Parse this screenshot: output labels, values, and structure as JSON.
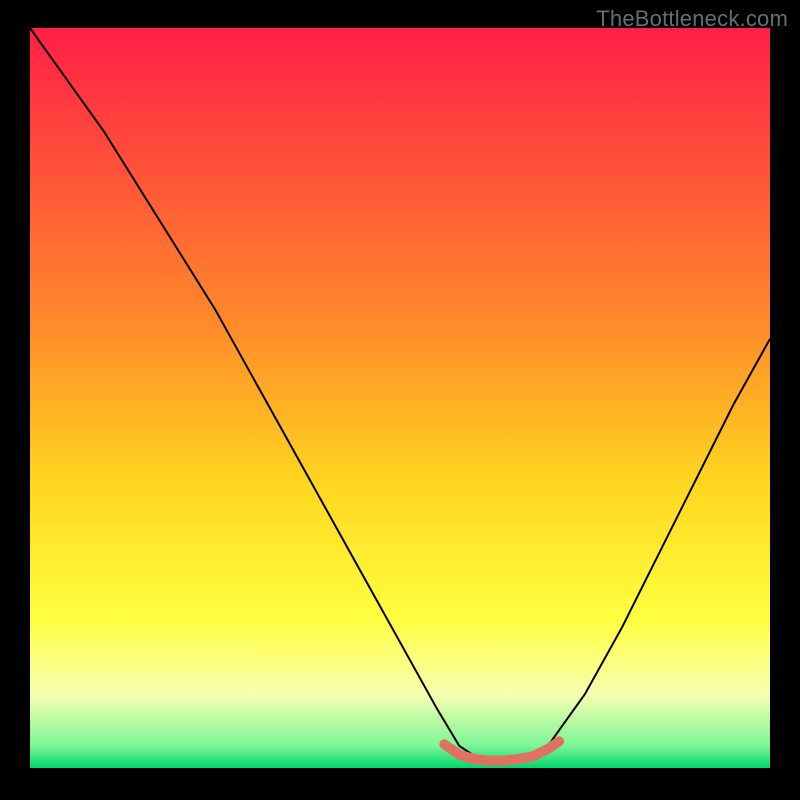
{
  "watermark": "TheBottleneck.com",
  "chart_data": {
    "type": "line",
    "title": "",
    "xlabel": "",
    "ylabel": "",
    "xlim": [
      0,
      100
    ],
    "ylim": [
      0,
      100
    ],
    "background_gradient": {
      "stops": [
        {
          "offset": 0,
          "color": "#ff1f47"
        },
        {
          "offset": 40,
          "color": "#ff8a2a"
        },
        {
          "offset": 62,
          "color": "#ffd81f"
        },
        {
          "offset": 80,
          "color": "#ffff40"
        },
        {
          "offset": 90,
          "color": "#f8ffb0"
        },
        {
          "offset": 97,
          "color": "#7cf598"
        },
        {
          "offset": 100,
          "color": "#00d66b"
        }
      ]
    },
    "series": [
      {
        "name": "bottleneck-curve",
        "x": [
          0,
          5,
          10,
          15,
          20,
          25,
          30,
          35,
          40,
          45,
          50,
          55,
          58,
          61,
          64,
          67,
          70,
          75,
          80,
          85,
          90,
          95,
          100
        ],
        "y": [
          100,
          93,
          86,
          78,
          70,
          62,
          53,
          44,
          35,
          26,
          17,
          8,
          3,
          1,
          1,
          1,
          3,
          10,
          19,
          29,
          39,
          49,
          58
        ]
      }
    ],
    "highlight_segment": {
      "name": "optimal-range",
      "color": "#e07060",
      "x": [
        56,
        58,
        60,
        62,
        64,
        66,
        68,
        70,
        71.5
      ],
      "y": [
        3.2,
        1.8,
        1.2,
        1.0,
        1.0,
        1.2,
        1.6,
        2.6,
        3.6
      ]
    }
  }
}
